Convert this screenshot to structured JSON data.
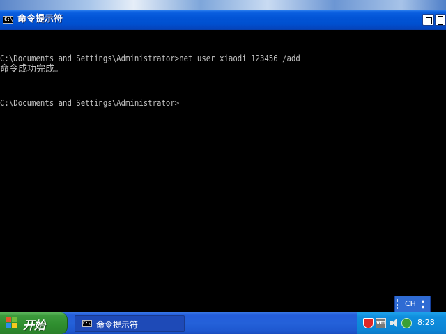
{
  "window": {
    "title": "命令提示符",
    "icon_text": "C:\\"
  },
  "console": {
    "lines": [
      "C:\\Documents and Settings\\Administrator>net user xiaodi 123456 /add",
      "命令成功完成。",
      "C:\\Documents and Settings\\Administrator>"
    ]
  },
  "language_bar": {
    "label": "CH"
  },
  "taskbar": {
    "start_label": "开始",
    "task_label": "命令提示符",
    "task_icon_text": "C:\\",
    "tray_vm_text": "vm",
    "clock": "8:28"
  },
  "colors": {
    "title_bar": "#0254d6",
    "console_bg": "#000000",
    "console_text": "#c0c0c0",
    "start_button": "#2f8f2f",
    "taskbar": "#245ddb",
    "tray": "#0f8ede"
  },
  "icons": [
    "cmd-icon",
    "restore-icon",
    "close-icon",
    "windows-flag-icon",
    "shield-icon",
    "vm-icon",
    "speaker-icon",
    "network-icon"
  ]
}
